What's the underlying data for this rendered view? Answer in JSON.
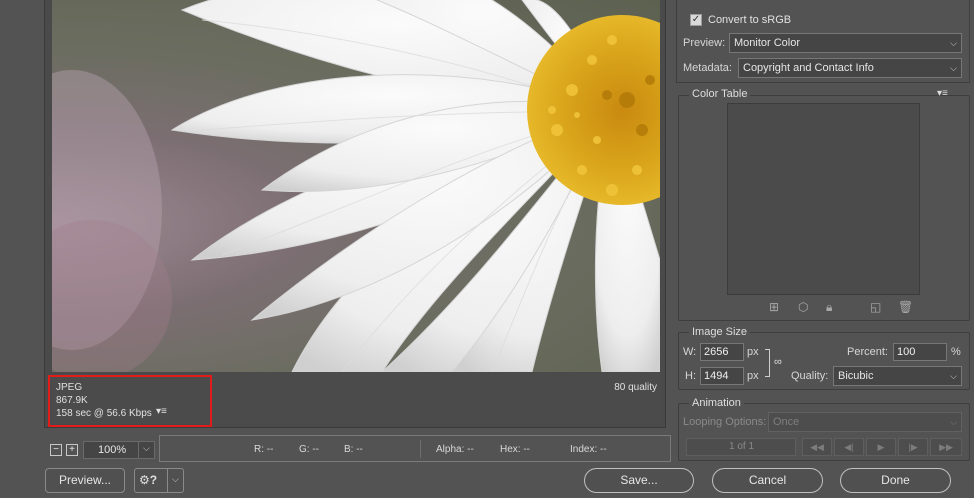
{
  "preview": {
    "format": "JPEG",
    "file_size": "867.9K",
    "download_time": "158 sec @ 56.6 Kbps",
    "quality": "80 quality"
  },
  "statusbar": {
    "zoom_out_label": "−",
    "zoom_in_label": "+",
    "zoom_value": "100%",
    "r": "R: --",
    "g": "G: --",
    "b": "B: --",
    "alpha": "Alpha: --",
    "hex": "Hex: --",
    "index": "Index: --"
  },
  "buttons": {
    "preview": "Preview...",
    "save": "Save...",
    "cancel": "Cancel",
    "done": "Done"
  },
  "settings": {
    "convert_srgb_label": "Convert to sRGB",
    "convert_srgb_checked": true,
    "preview_label": "Preview:",
    "preview_value": "Monitor Color",
    "metadata_label": "Metadata:",
    "metadata_value": "Copyright and Contact Info"
  },
  "color_table": {
    "title": "Color Table"
  },
  "image_size": {
    "title": "Image Size",
    "w_label": "W:",
    "w_value": "2656",
    "h_label": "H:",
    "h_value": "1494",
    "unit": "px",
    "percent_label": "Percent:",
    "percent_value": "100",
    "percent_unit": "%",
    "quality_label": "Quality:",
    "quality_value": "Bicubic"
  },
  "animation": {
    "title": "Animation",
    "looping_label": "Looping Options:",
    "looping_value": "Once",
    "frame_counter": "1 of 1"
  },
  "colors": {
    "highlight": "#e21b1b",
    "panel_bg": "#535353"
  }
}
